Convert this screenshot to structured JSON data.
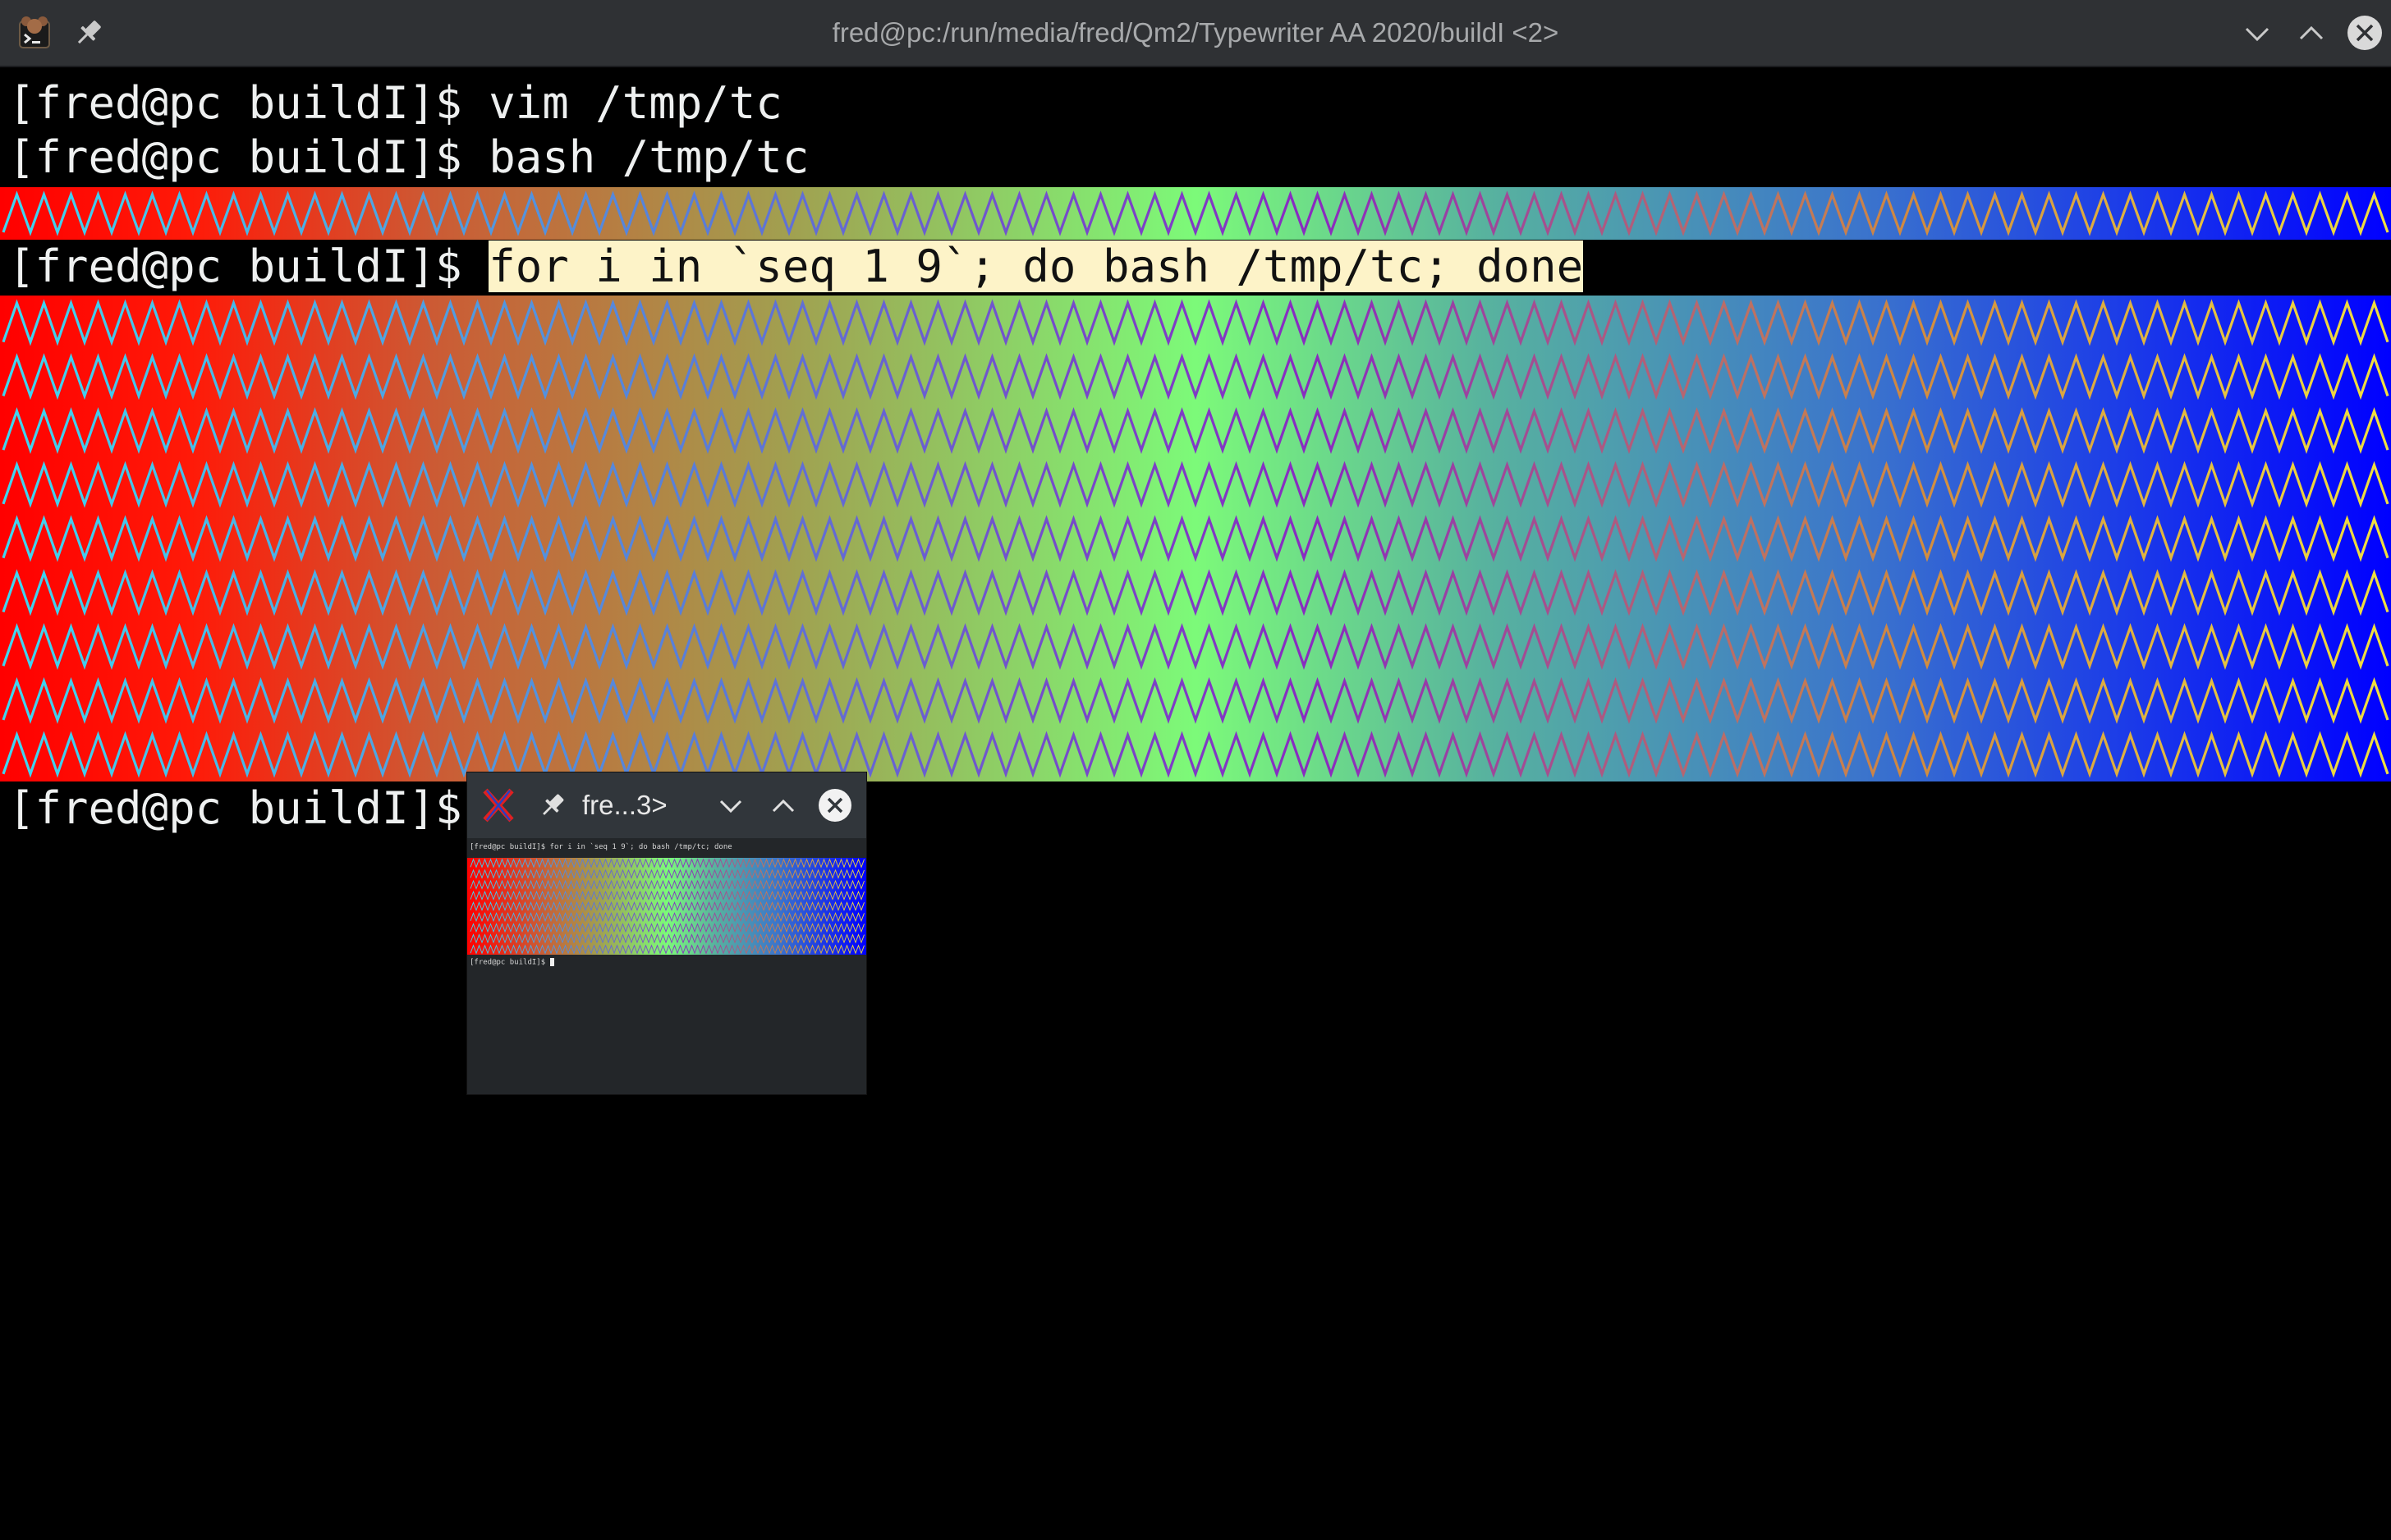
{
  "window": {
    "title": "fred@pc:/run/media/fred/Qm2/Typewriter AA 2020/buildI <2>",
    "icons": {
      "app": "terminal-app-icon",
      "pin": "pin-icon",
      "minimize": "chevron-down-icon",
      "maximize": "chevron-up-icon",
      "close": "close-circle-icon"
    }
  },
  "terminal": {
    "prompt": "[fred@pc buildI]$ ",
    "lines": [
      {
        "command": "vim /tmp/tc"
      },
      {
        "command": "bash /tmp/tc"
      }
    ],
    "highlighted_command": "for i in `seq 1 9`; do bash /tmp/tc; done",
    "gradient_colors": [
      "#ff0000",
      "#cc5a34",
      "#a1a050",
      "#7cfa79",
      "#58b39e",
      "#3b74cc",
      "#0000ff"
    ]
  },
  "thumbnail": {
    "title": "fre...3>",
    "mini_command_line": "[fred@pc buildI]$ for i in `seq 1 9`; do bash /tmp/tc; done",
    "mini_prompt": "[fred@pc buildI]$"
  }
}
